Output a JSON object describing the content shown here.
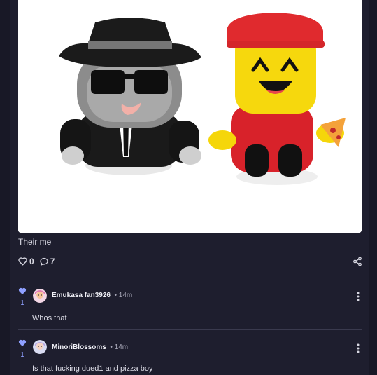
{
  "post": {
    "caption": "Their me",
    "likes": "0",
    "comments_count": "7",
    "image_alt": "Two plush toys: one in black suit with fedora and sunglasses, one yellow with red cap holding pizza slice"
  },
  "icons": {
    "like": "heart-outline-icon",
    "comment": "speech-bubble-icon",
    "share": "share-icon",
    "upvote": "heart-filled-icon",
    "more": "vertical-dots-icon"
  },
  "comments": [
    {
      "author": "Emukasa fan3926",
      "time": "14m",
      "votes": "1",
      "text": "Whos that"
    },
    {
      "author": "MinoriBlossoms",
      "time": "14m",
      "votes": "1",
      "text": "Is that fucking dued1 and pizza boy"
    }
  ],
  "colors": {
    "background": "#1e1e2e",
    "accent": "#8fa0ff",
    "divider": "#3a3a4e"
  }
}
